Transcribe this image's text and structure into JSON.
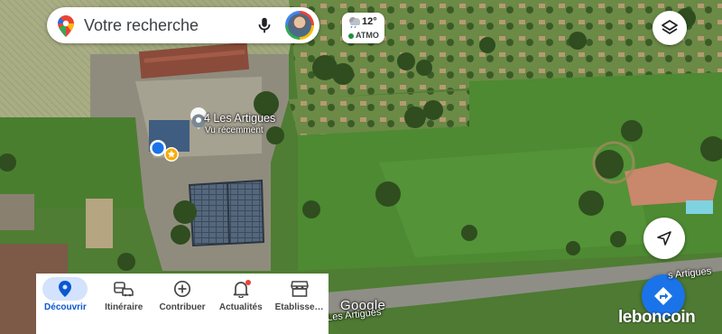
{
  "search": {
    "placeholder": "Votre recherche"
  },
  "weather": {
    "temperature": "12°",
    "air_quality": "ATMO"
  },
  "place": {
    "name": "4 Les Artigues",
    "subtitle": "Vu récemment"
  },
  "map_labels": {
    "attribution": "Google",
    "road_left": "Les Artigues",
    "road_right": "s Artigues"
  },
  "watermark": "leboncoin",
  "bottom_nav": {
    "items": [
      {
        "label": "Découvrir",
        "icon": "location-pin-icon",
        "active": true
      },
      {
        "label": "Itinéraire",
        "icon": "commute-icon",
        "active": false
      },
      {
        "label": "Contribuer",
        "icon": "add-circle-icon",
        "active": false
      },
      {
        "label": "Actualités",
        "icon": "bell-icon",
        "active": false
      },
      {
        "label": "Établisse…",
        "icon": "storefront-icon",
        "active": false
      }
    ]
  },
  "colors": {
    "accent": "#1a73e8",
    "nav_active_bg": "#d3e3fd",
    "nav_active_text": "#0b57d0"
  }
}
